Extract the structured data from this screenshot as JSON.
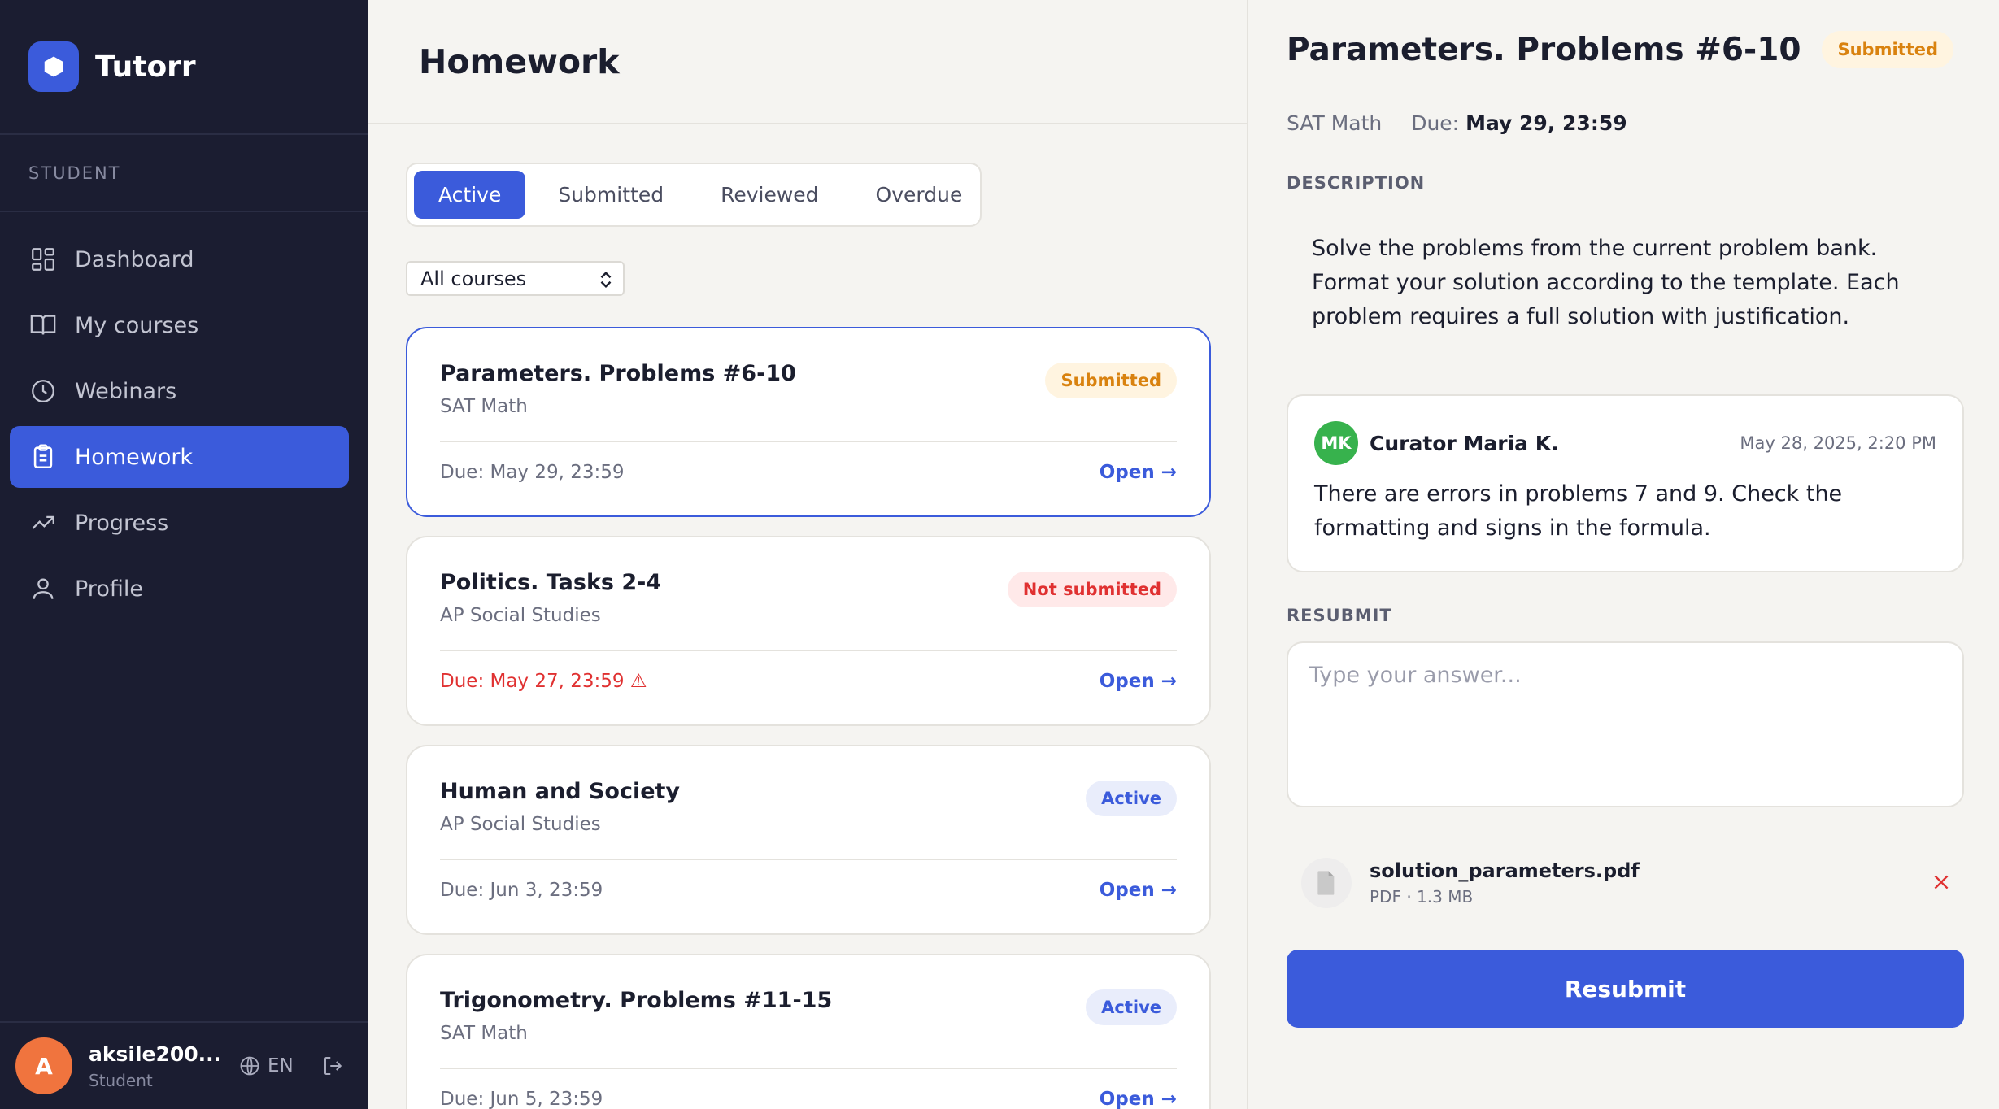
{
  "app": {
    "name": "Tutorr"
  },
  "sidebar": {
    "section_label": "STUDENT",
    "items": [
      {
        "label": "Dashboard",
        "icon": "dashboard-icon"
      },
      {
        "label": "My courses",
        "icon": "book-icon"
      },
      {
        "label": "Webinars",
        "icon": "clock-icon"
      },
      {
        "label": "Homework",
        "icon": "clipboard-icon",
        "active": true
      },
      {
        "label": "Progress",
        "icon": "trending-up-icon"
      },
      {
        "label": "Profile",
        "icon": "user-icon"
      }
    ],
    "user": {
      "initial": "A",
      "name": "aksile200...",
      "role": "Student",
      "language": "EN"
    }
  },
  "main": {
    "title": "Homework",
    "tabs": [
      {
        "label": "Active",
        "active": true
      },
      {
        "label": "Submitted"
      },
      {
        "label": "Reviewed"
      },
      {
        "label": "Overdue"
      }
    ],
    "course_filter": {
      "selected": "All courses"
    },
    "cards": [
      {
        "title": "Parameters. Problems #6-10",
        "course": "SAT Math",
        "status": "Submitted",
        "due": "Due: May 29, 23:59",
        "open": "Open →"
      },
      {
        "title": "Politics. Tasks 2-4",
        "course": "AP Social Studies",
        "status": "Not submitted",
        "due": "Due: May 27, 23:59 ⚠",
        "open": "Open →"
      },
      {
        "title": "Human and Society",
        "course": "AP Social Studies",
        "status": "Active",
        "due": "Due: Jun 3, 23:59",
        "open": "Open →"
      },
      {
        "title": "Trigonometry. Problems #11-15",
        "course": "SAT Math",
        "status": "Active",
        "due": "Due: Jun 5, 23:59",
        "open": "Open →"
      }
    ]
  },
  "detail": {
    "title": "Parameters. Problems #6-10",
    "status": "Submitted",
    "course": "SAT Math",
    "due_label": "Due:",
    "due_value": "May 29, 23:59",
    "description_label": "DESCRIPTION",
    "description": "Solve the problems from the current problem bank. Format your solution according to the template. Each problem requires a full solution with justification.",
    "comment": {
      "initials": "MK",
      "author": "Curator Maria K.",
      "date": "May 28, 2025, 2:20 PM",
      "text": "There are errors in problems 7 and 9. Check the formatting and signs in the formula."
    },
    "resubmit_label": "RESUBMIT",
    "answer_placeholder": "Type your answer...",
    "file": {
      "name": "solution_parameters.pdf",
      "meta": "PDF · 1.3 MB"
    },
    "submit_button": "Resubmit"
  },
  "colors": {
    "accent": "#3b5bdb",
    "sidebar_bg": "#1b1d31",
    "submitted": "#d9820f",
    "not_submitted": "#e03131",
    "avatar_user": "#f0743e",
    "avatar_curator": "#37b24d"
  }
}
